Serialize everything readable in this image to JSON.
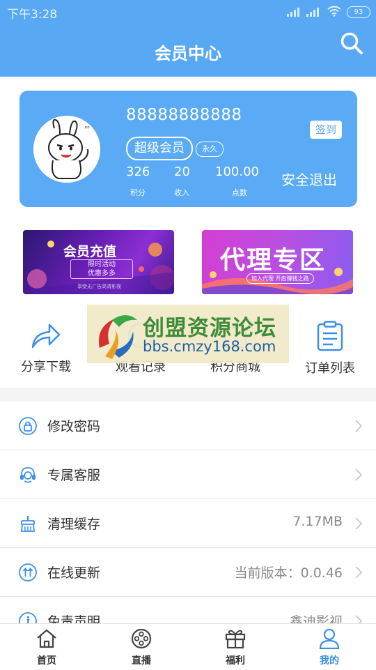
{
  "status_bar": {
    "time": "下午3:28",
    "battery": "93"
  },
  "header": {
    "title": "会员中心",
    "search_icon": "search-icon"
  },
  "member_card": {
    "phone": "88888888888",
    "level": "超级会员",
    "duration": "永久",
    "stats": [
      {
        "value": "326",
        "label": "积分"
      },
      {
        "value": "20",
        "label": "收入"
      },
      {
        "value": "100.00",
        "label": "点数"
      }
    ],
    "signin_label": "签到",
    "logout_label": "安全退出"
  },
  "banners": {
    "recharge": {
      "title": "会员充值",
      "line1": "限时活动",
      "line2": "优惠多多",
      "footer": "享受无广告高清影视"
    },
    "agent": {
      "title": "代理专区",
      "subtitle": "加入代理 开启赚钱之路"
    }
  },
  "quick_actions": [
    {
      "label": "分享下载",
      "icon": "share-icon"
    },
    {
      "label": "观看记录",
      "icon": "history-icon"
    },
    {
      "label": "积分商城",
      "icon": "mall-icon"
    },
    {
      "label": "订单列表",
      "icon": "clipboard-icon"
    }
  ],
  "watermark": {
    "text": "创盟资源论坛",
    "url": "bbs.cmzy168.com"
  },
  "menu": [
    {
      "label": "修改密码",
      "value": "",
      "icon": "lock-icon"
    },
    {
      "label": "专属客服",
      "value": "",
      "icon": "headset-icon"
    },
    {
      "label": "清理缓存",
      "value": "7.17MB",
      "icon": "broom-icon"
    },
    {
      "label": "在线更新",
      "value": "当前版本：0.0.46",
      "icon": "update-icon"
    },
    {
      "label": "免责声明",
      "value": "鑫迪影视",
      "icon": "info-icon"
    }
  ],
  "tabs": [
    {
      "label": "首页",
      "icon": "home-icon"
    },
    {
      "label": "直播",
      "icon": "film-reel-icon"
    },
    {
      "label": "福利",
      "icon": "gift-icon"
    },
    {
      "label": "我的",
      "icon": "user-icon"
    }
  ],
  "colors": {
    "primary": "#58a8f3",
    "tab_active": "#3b8fe4",
    "icon_blue": "#3b8fe4"
  }
}
